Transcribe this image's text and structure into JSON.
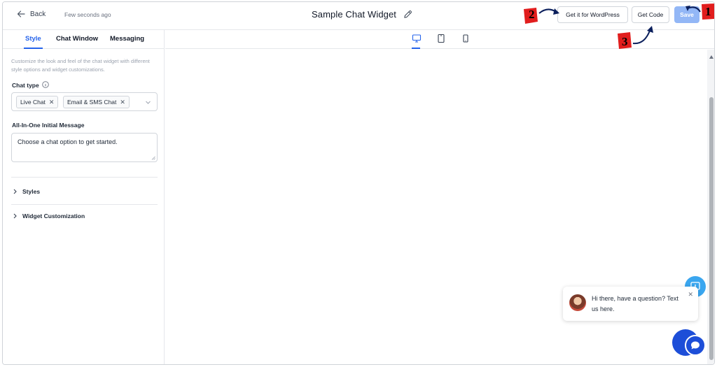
{
  "header": {
    "back_label": "Back",
    "saved_status": "Few seconds ago",
    "title": "Sample Chat Widget",
    "wordpress_button": "Get it for WordPress",
    "get_code_button": "Get Code",
    "save_button": "Save"
  },
  "annotations": [
    "1",
    "2",
    "3"
  ],
  "colors": {
    "accent": "#2563eb",
    "save_disabled": "#93b7f6",
    "annotation_red": "#e11d1d",
    "launcher_blue": "#1d4ed8",
    "feedback_blue": "#3aa6ef"
  },
  "sidebar": {
    "tabs": [
      {
        "label": "Style",
        "active": true
      },
      {
        "label": "Chat Window",
        "active": false
      },
      {
        "label": "Messaging",
        "active": false
      }
    ],
    "description": "Customize the look and feel of the chat widget with different style options and widget customizations.",
    "chat_type": {
      "label": "Chat type",
      "selected": [
        "Live Chat",
        "Email & SMS Chat"
      ]
    },
    "initial_message": {
      "label": "All-In-One Initial Message",
      "value": "Choose a chat option to get started."
    },
    "sections": [
      "Styles",
      "Widget Customization"
    ]
  },
  "preview": {
    "devices": [
      "desktop-icon",
      "tablet-icon",
      "mobile-icon"
    ],
    "active_device": "desktop",
    "bubble_text": "Hi there, have a question? Text us here."
  }
}
